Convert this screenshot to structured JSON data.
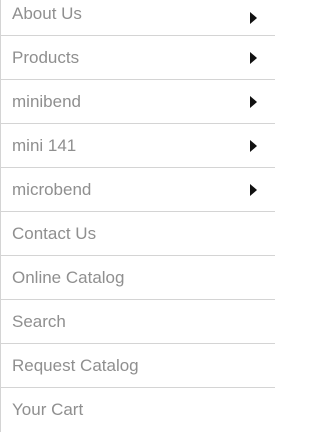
{
  "menu": {
    "items": [
      {
        "label": "About Us",
        "has_submenu": true
      },
      {
        "label": "Products",
        "has_submenu": true
      },
      {
        "label": "minibend",
        "has_submenu": true
      },
      {
        "label": "mini 141",
        "has_submenu": true
      },
      {
        "label": "microbend",
        "has_submenu": true
      },
      {
        "label": "Contact Us",
        "has_submenu": false
      },
      {
        "label": "Online Catalog",
        "has_submenu": false
      },
      {
        "label": "Search",
        "has_submenu": false
      },
      {
        "label": "Request Catalog",
        "has_submenu": false
      },
      {
        "label": "Your Cart",
        "has_submenu": false
      }
    ],
    "colors": {
      "text": "#8f8f8f",
      "divider": "#d4d4d4",
      "arrow": "#111111"
    },
    "icons": {
      "submenu": "triangle-right-icon"
    }
  }
}
